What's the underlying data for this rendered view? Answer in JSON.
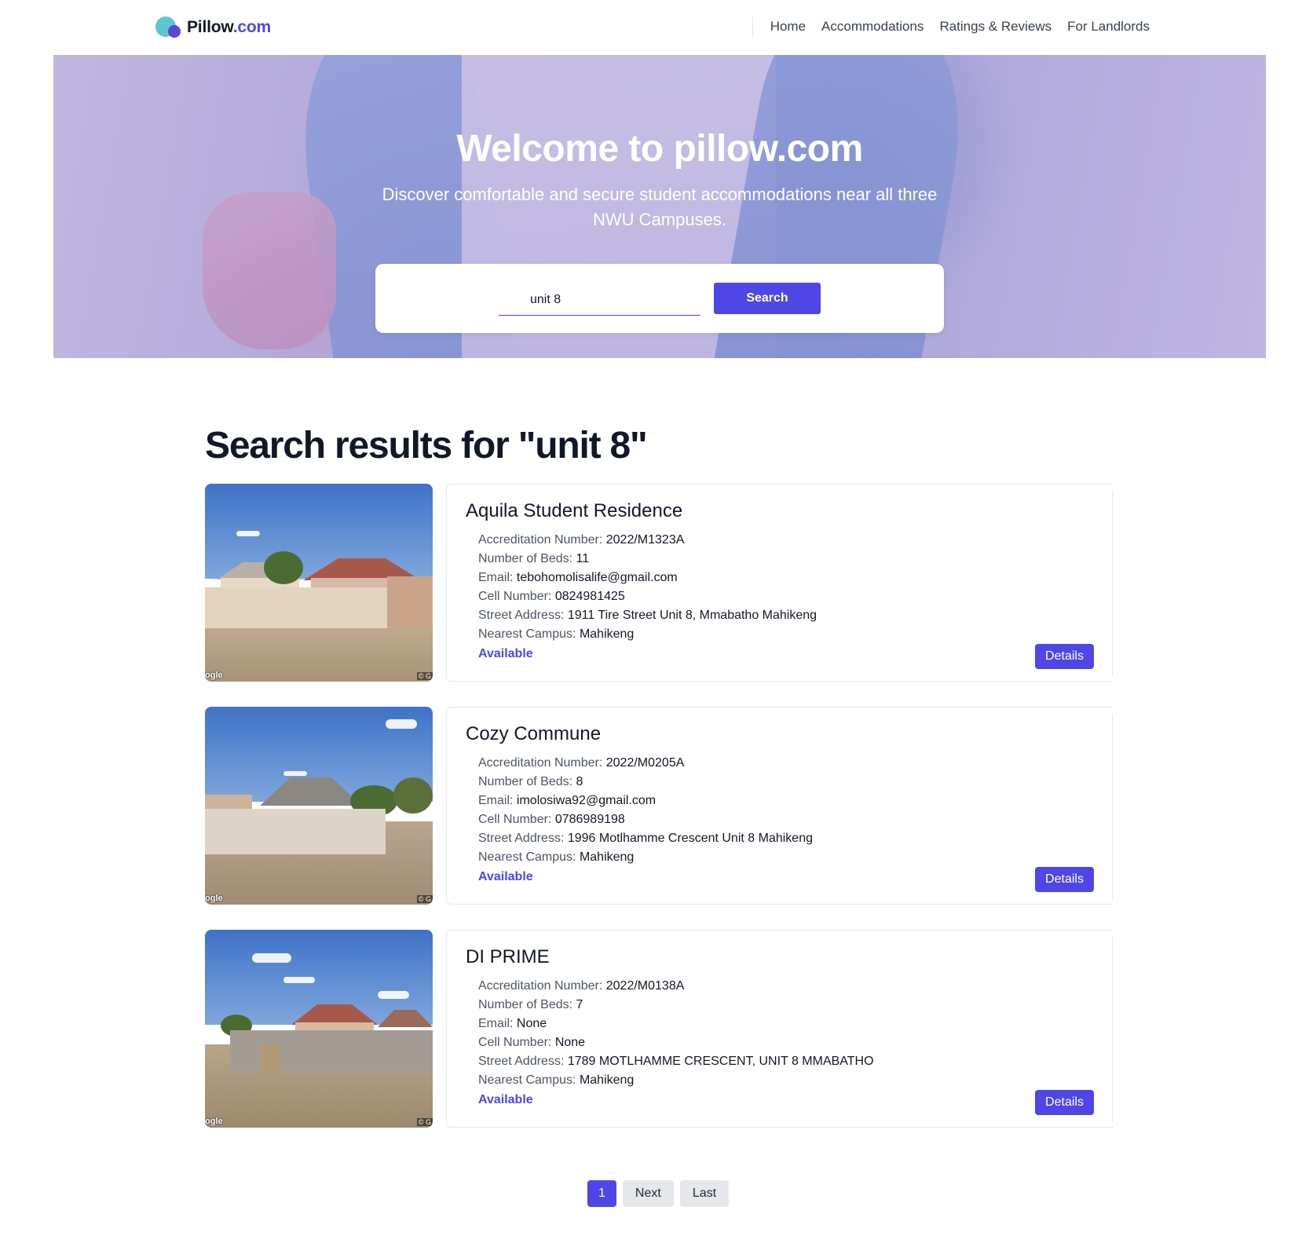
{
  "header": {
    "logo_main": "Pillow",
    "logo_domain": ".com",
    "nav": [
      "Home",
      "Accommodations",
      "Ratings & Reviews",
      "For Landlords"
    ]
  },
  "hero": {
    "title": "Welcome to pillow.com",
    "subtitle": "Discover comfortable and secure student accommodations near all three NWU Campuses.",
    "search_value": "unit 8",
    "search_button": "Search"
  },
  "results": {
    "title": "Search results for \"unit 8\"",
    "labels": {
      "accreditation": "Accreditation Number:",
      "beds": "Number of Beds:",
      "email": "Email:",
      "cell": "Cell Number:",
      "address": "Street Address:",
      "campus": "Nearest Campus:"
    },
    "details_label": "Details",
    "image_watermark_left": "ogle",
    "image_watermark_right": "© G",
    "items": [
      {
        "name": "Aquila Student Residence",
        "accreditation": "2022/M1323A",
        "beds": "11",
        "email": "tebohomolisalife@gmail.com",
        "cell": "0824981425",
        "address": "1911 Tire Street Unit 8, Mmabatho Mahikeng",
        "campus": "Mahikeng",
        "status": "Available"
      },
      {
        "name": "Cozy Commune",
        "accreditation": "2022/M0205A",
        "beds": "8",
        "email": "imolosiwa92@gmail.com",
        "cell": "0786989198",
        "address": "1996 Motlhamme Crescent Unit 8 Mahikeng",
        "campus": "Mahikeng",
        "status": "Available"
      },
      {
        "name": "DI PRIME",
        "accreditation": "2022/M0138A",
        "beds": "7",
        "email": "None",
        "cell": "None",
        "address": "1789 MOTLHAMME CRESCENT, UNIT 8 MMABATHO",
        "campus": "Mahikeng",
        "status": "Available"
      }
    ]
  },
  "pagination": {
    "current": "1",
    "next": "Next",
    "last": "Last"
  },
  "colors": {
    "accent": "#4f46e5",
    "logo_teal": "#5ec6d0"
  }
}
